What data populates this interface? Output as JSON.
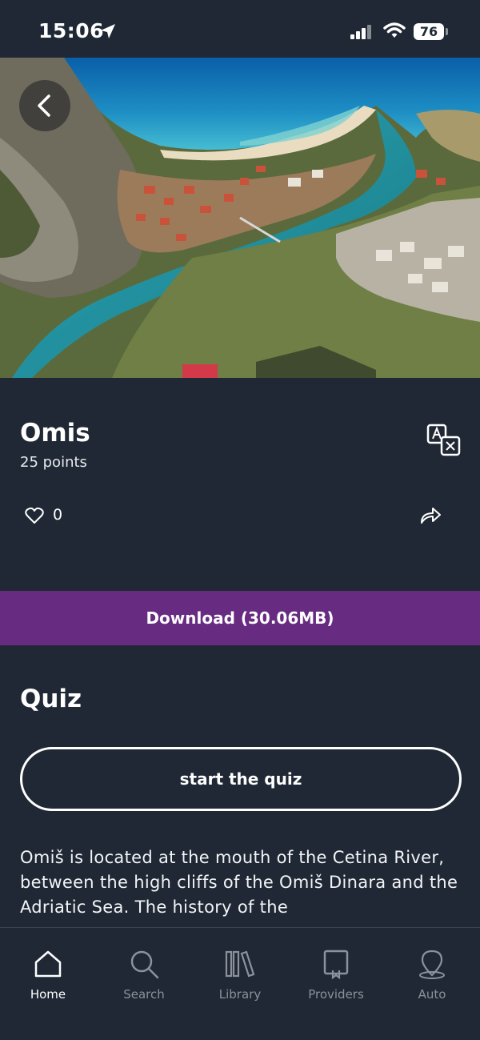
{
  "status_bar": {
    "time": "15:06",
    "battery": "76"
  },
  "place": {
    "title": "Omis",
    "points": "25 points",
    "likes": "0"
  },
  "download": {
    "label": "Download (30.06MB)"
  },
  "quiz": {
    "heading": "Quiz",
    "button_label": "start the quiz"
  },
  "description": "Omiš is located at the mouth of the Cetina River, between the high cliffs of the Omiš Dinara and the Adriatic Sea. The history of the",
  "tabs": [
    {
      "label": "Home",
      "icon": "home-icon",
      "active": true
    },
    {
      "label": "Search",
      "icon": "search-icon",
      "active": false
    },
    {
      "label": "Library",
      "icon": "library-icon",
      "active": false
    },
    {
      "label": "Providers",
      "icon": "providers-icon",
      "active": false
    },
    {
      "label": "Auto",
      "icon": "auto-icon",
      "active": false
    }
  ],
  "colors": {
    "background": "#1f2834",
    "accent": "#672b82",
    "inactive": "#8b929b"
  }
}
